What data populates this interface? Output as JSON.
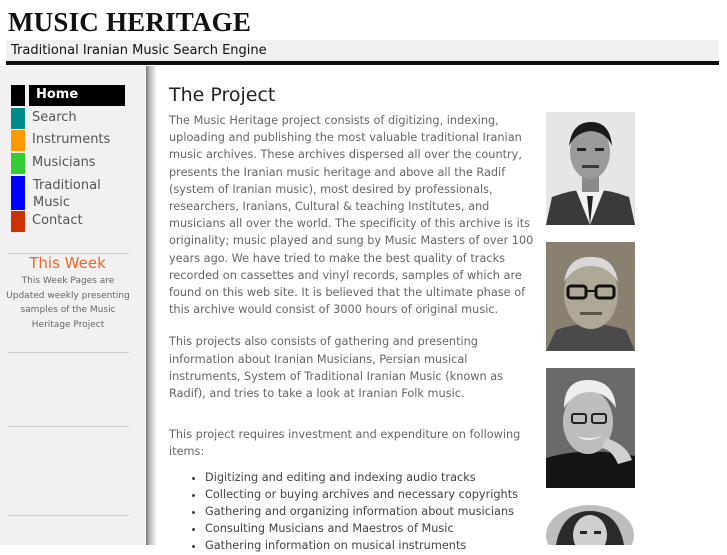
{
  "header": {
    "title": "MUSIC HERITAGE",
    "subtitle": "Traditional Iranian Music Search Engine"
  },
  "nav": {
    "items": [
      {
        "label": "Home",
        "color": "#000000",
        "active": true
      },
      {
        "label": "Search",
        "color": "#008b8b"
      },
      {
        "label": "Instruments",
        "color": "#ff9900"
      },
      {
        "label": "Musicians",
        "color": "#33cc33"
      },
      {
        "label": "Traditional Music",
        "color": "#0000ff"
      },
      {
        "label": "Contact",
        "color": "#cc3300"
      }
    ]
  },
  "sidebar": {
    "week_title": "This Week",
    "week_text": "This Week Pages are Updated weekly presenting samples of the Music Heritage Project"
  },
  "main": {
    "title": "The Project",
    "para1": "The Music Heritage project consists of digitizing, indexing, uploading and publishing the most valuable traditional Iranian music archives. These archives dispersed all over the country, presents the Iranian music heritage and above all the Radif (system of Iranian music), most desired by professionals, researchers, Iranians, Cultural & teaching  Institutes, and musicians all over the world. The specificity of this archive is its originality; music played and sung by Music Masters of over 100 years ago. We have tried to make the best quality of tracks recorded on cassettes and vinyl records, samples of which are found on this web site. It is believed that the ultimate phase of this archive would consist of 3000 hours of original music.",
    "para2": "This projects also consists of gathering and presenting information about Iranian Musicians, Persian musical instruments, System of Traditional Iranian Music (known as Radif), and tries to take a look at Iranian Folk music.",
    "para3": "This project requires investment and expenditure on following items:",
    "list": [
      "Digitizing and editing and indexing audio tracks",
      "Collecting or buying archives and necessary copyrights",
      "Gathering and organizing information about musicians",
      "Consulting Musicians and Maestros of Music",
      "Gathering information on musical instruments"
    ]
  }
}
